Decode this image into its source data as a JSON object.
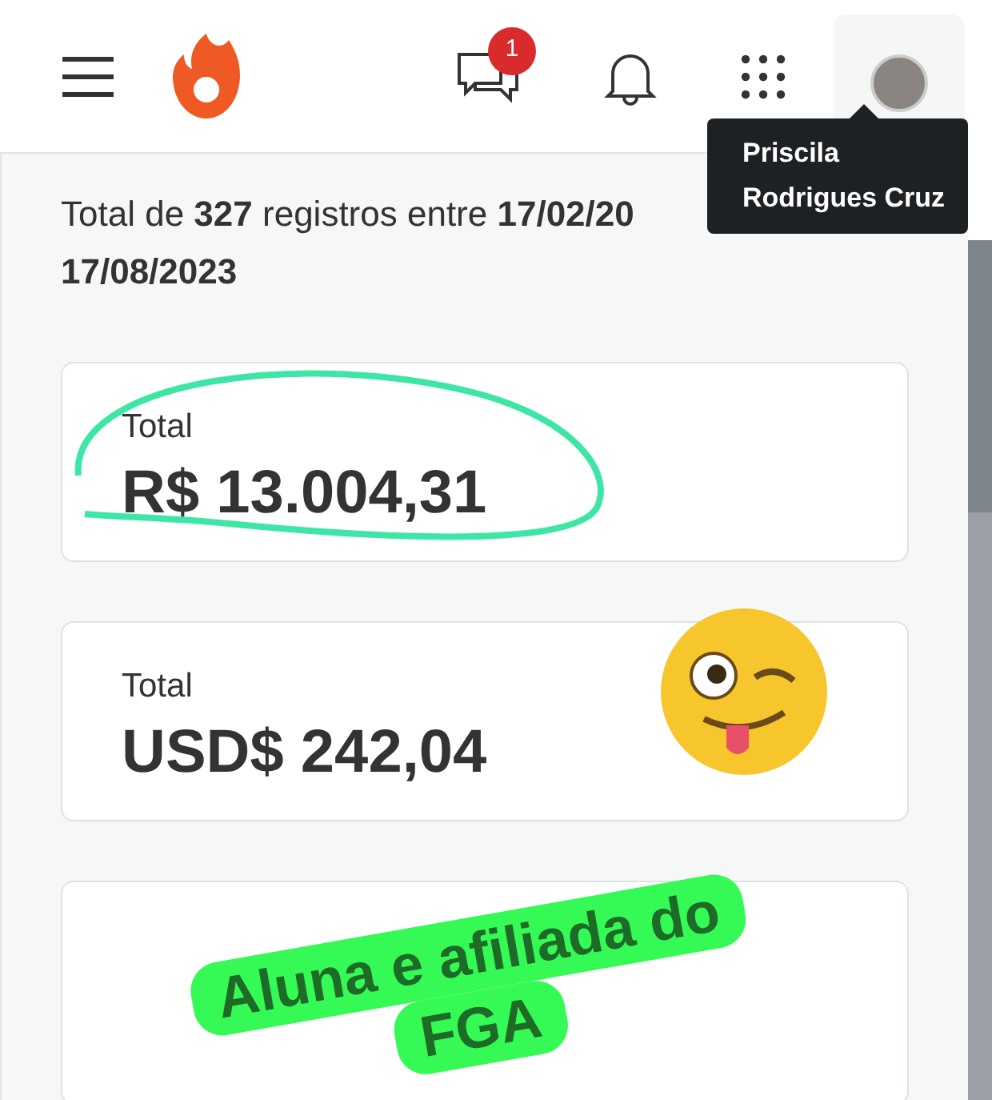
{
  "header": {
    "chat_badge": "1"
  },
  "tooltip": {
    "lines": [
      "Priscila",
      "Rodrigues Cruz"
    ]
  },
  "summary": [
    "Total de **327** registros entre **17/02/20**",
    "**17/08/2023**"
  ],
  "cards": [
    {
      "label": "Total",
      "value": "R$ 13.004,31",
      "circled": true
    },
    {
      "label": "Total",
      "value": "USD$ 242,04",
      "circled": false
    }
  ],
  "sticker": {
    "lines": [
      "Aluna e afiliada do",
      "FGA"
    ]
  }
}
